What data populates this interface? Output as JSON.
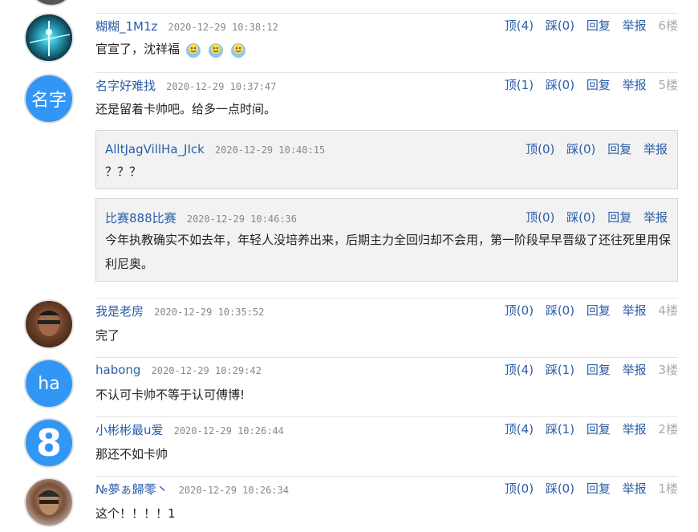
{
  "colors": {
    "link": "#2a5ea8",
    "avatar_blue": "#3296f5"
  },
  "actions": {
    "up": "顶",
    "down": "踩",
    "reply": "回复",
    "report": "举报"
  },
  "comments": [
    {
      "user": "糊糊_1M1z",
      "time": "2020-12-29 10:38:12",
      "up": "顶(4)",
      "down": "踩(0)",
      "floor": "6楼",
      "content": "官宣了，沈祥福",
      "emoji": [
        "smiley-emoji",
        "smiley-emoji",
        "smiley-emoji"
      ]
    },
    {
      "user": "名字好难找",
      "time": "2020-12-29 10:37:47",
      "up": "顶(1)",
      "down": "踩(0)",
      "floor": "5楼",
      "content": "还是留着卡帅吧。给多一点时间。",
      "avatar_text": "名字",
      "replies": [
        {
          "user": "AlltJagVillHa_JIck",
          "time": "2020-12-29 10:40:15",
          "up": "顶(0)",
          "down": "踩(0)",
          "content": "？？？"
        },
        {
          "user": "比赛888比赛",
          "time": "2020-12-29 10:46:36",
          "up": "顶(0)",
          "down": "踩(0)",
          "content": "今年执教确实不如去年，年轻人没培养出来，后期主力全回归却不会用，第一阶段早早晋级了还往死里用保利尼奥。"
        }
      ]
    },
    {
      "user": "我是老房",
      "time": "2020-12-29 10:35:52",
      "up": "顶(0)",
      "down": "踩(0)",
      "floor": "4楼",
      "content": "完了"
    },
    {
      "user": "habong",
      "time": "2020-12-29 10:29:42",
      "up": "顶(4)",
      "down": "踩(1)",
      "floor": "3楼",
      "content": "不认可卡帅不等于认可傅博!",
      "avatar_text": "ha"
    },
    {
      "user": "小彬彬最u爱",
      "time": "2020-12-29 10:26:44",
      "up": "顶(4)",
      "down": "踩(1)",
      "floor": "2楼",
      "content": "那还不如卡帅",
      "avatar_text": "8"
    },
    {
      "user": "№夢ぁ歸蕶丶",
      "time": "2020-12-29 10:26:34",
      "up": "顶(0)",
      "down": "踩(0)",
      "floor": "1楼",
      "content": "这个！！！！1"
    }
  ]
}
